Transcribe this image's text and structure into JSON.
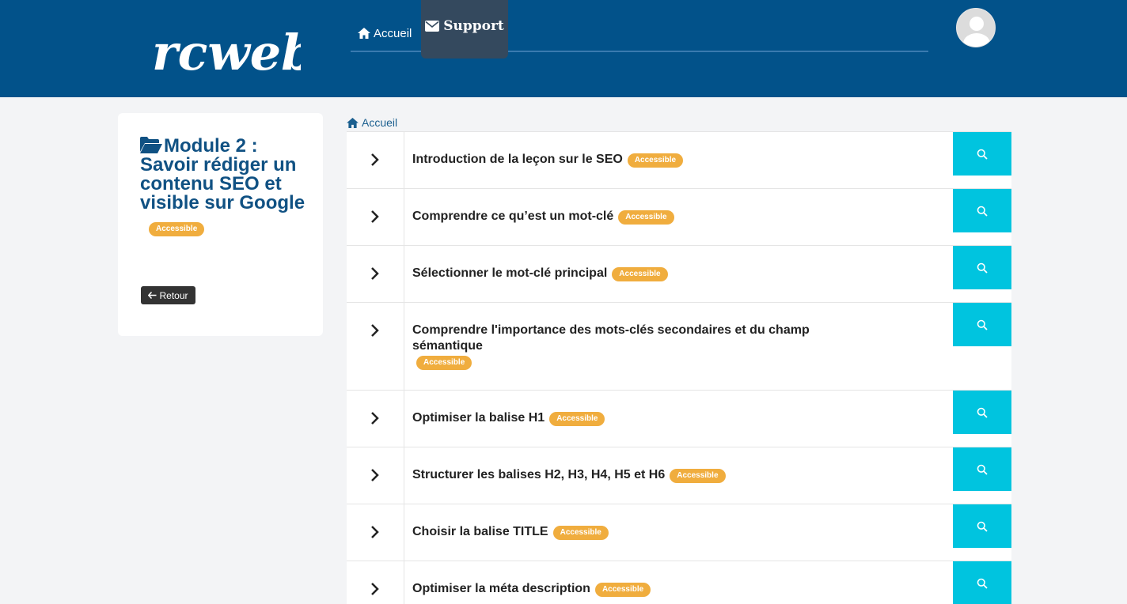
{
  "header": {
    "logo_text": "rcweb",
    "nav": {
      "home_label": "Accueil",
      "support_label": "Support"
    }
  },
  "sidebar": {
    "module_title": "Module 2 : Savoir rédiger un contenu SEO et visible sur Google",
    "badge": "Accessible",
    "back_label": "Retour"
  },
  "breadcrumb": {
    "home_label": "Accueil"
  },
  "lessons": [
    {
      "title": "Introduction de la leçon sur le SEO",
      "badge": "Accessible"
    },
    {
      "title": "Comprendre ce qu’est un mot-clé",
      "badge": "Accessible"
    },
    {
      "title": "Sélectionner le mot-clé principal",
      "badge": "Accessible"
    },
    {
      "title": "Comprendre l'importance des mots-clés secondaires et du champ sémantique",
      "badge": "Accessible"
    },
    {
      "title": "Optimiser la balise H1",
      "badge": "Accessible"
    },
    {
      "title": "Structurer les balises H2, H3, H4, H5 et H6",
      "badge": "Accessible"
    },
    {
      "title": "Choisir la balise TITLE",
      "badge": "Accessible"
    },
    {
      "title": "Optimiser la méta description",
      "badge": "Accessible"
    }
  ],
  "colors": {
    "header_bg": "#02528a",
    "support_bg": "#34495e",
    "badge": "#f0ad3e",
    "search_button": "#00c4df",
    "title_blue": "#105183"
  },
  "icons": {
    "nav_home": "home-icon",
    "nav_support": "envelope-icon",
    "folder": "folder-open-icon",
    "back": "arrow-left-icon",
    "expand": "chevron-right-icon",
    "preview": "search-icon"
  }
}
